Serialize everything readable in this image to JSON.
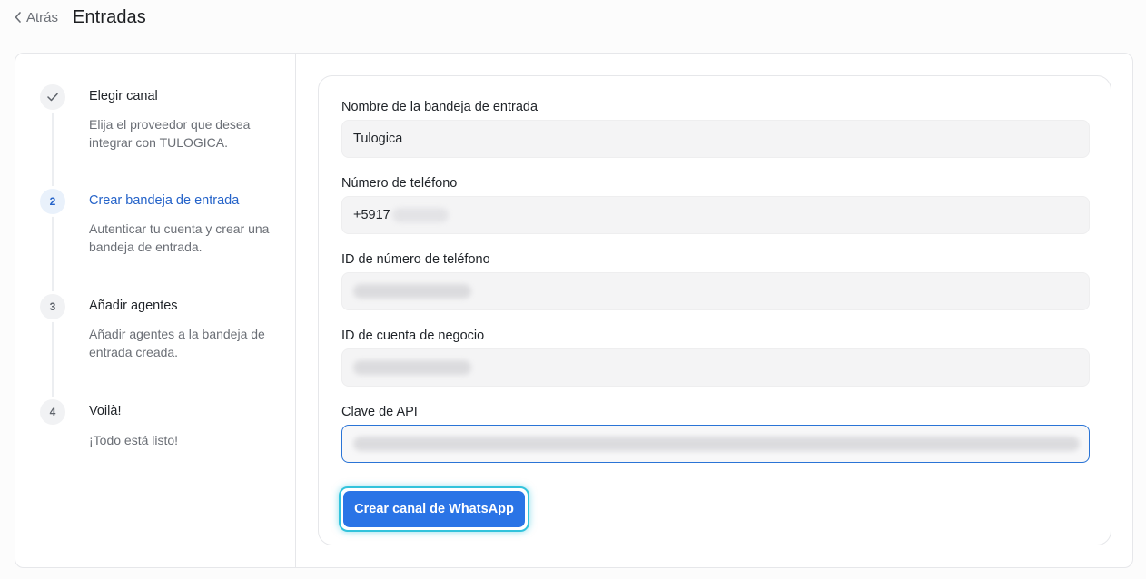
{
  "header": {
    "back_label": "Atrás",
    "title": "Entradas"
  },
  "steps": [
    {
      "number": "",
      "title": "Elegir canal",
      "desc": "Elija el proveedor que desea integrar con TULOGICA.",
      "state": "done"
    },
    {
      "number": "2",
      "title": "Crear bandeja de entrada",
      "desc": "Autenticar tu cuenta y crear una bandeja de entrada.",
      "state": "active"
    },
    {
      "number": "3",
      "title": "Añadir agentes",
      "desc": "Añadir agentes a la bandeja de entrada creada.",
      "state": "pending"
    },
    {
      "number": "4",
      "title": "Voilà!",
      "desc": "¡Todo está listo!",
      "state": "pending"
    }
  ],
  "form": {
    "inbox_name_label": "Nombre de la bandeja de entrada",
    "inbox_name_value": "Tulogica",
    "phone_label": "Número de teléfono",
    "phone_value": "+5917",
    "phone_id_label": "ID de número de teléfono",
    "business_id_label": "ID de cuenta de negocio",
    "api_key_label": "Clave de API",
    "submit_label": "Crear canal de WhatsApp"
  },
  "colors": {
    "accent": "#2a74e6",
    "focus_ring": "#32c3dc"
  }
}
